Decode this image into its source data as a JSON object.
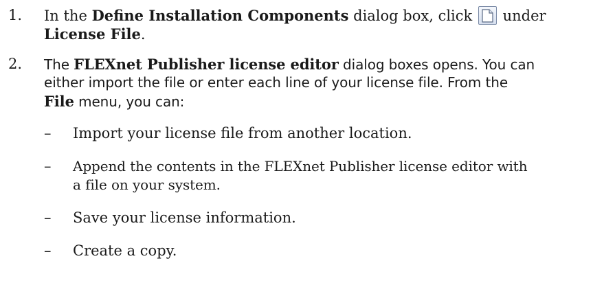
{
  "steps": [
    {
      "number": "1.",
      "line1_before": "In the ",
      "dialog_name": "Define Installation Components",
      "line1_middle": " dialog box, click ",
      "line1_after": " under",
      "field_name": "License File",
      "line2_after": "."
    },
    {
      "number": "2.",
      "before_bold": "The ",
      "editor_name": "FLEXnet Publisher license editor",
      "sentence_rest_line1": " dialog boxes opens. You can",
      "line2": "either import the file or enter each line of your license file. From the",
      "menu_name": "File",
      "menu_rest": " menu, you can:"
    }
  ],
  "bullets": [
    {
      "dash": "–",
      "lines": [
        "Import your license file from another location."
      ]
    },
    {
      "dash": "–",
      "lines": [
        "Append the contents in the FLEXnet Publisher license editor with",
        "a file on your system."
      ]
    },
    {
      "dash": "–",
      "lines": [
        "Save your license information."
      ]
    },
    {
      "dash": "–",
      "lines": [
        "Create a copy."
      ]
    }
  ],
  "icons": {
    "new_document_button": "new-document-icon"
  }
}
